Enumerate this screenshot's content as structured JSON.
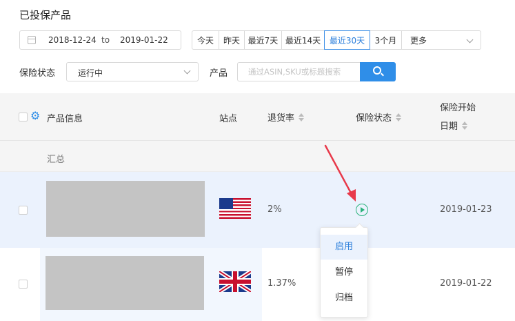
{
  "page": {
    "title": "已投保产品"
  },
  "date_range": {
    "start": "2018-12-24",
    "separator": "to",
    "end": "2019-01-22"
  },
  "range_buttons": [
    {
      "label": "今天",
      "active": false
    },
    {
      "label": "昨天",
      "active": false
    },
    {
      "label": "最近7天",
      "active": false
    },
    {
      "label": "最近14天",
      "active": false
    },
    {
      "label": "最近30天",
      "active": true
    },
    {
      "label": "3个月",
      "active": false
    }
  ],
  "more_select": {
    "label": "更多"
  },
  "filters": {
    "status_label": "保险状态",
    "status_value": "运行中",
    "product_label": "产品",
    "search_placeholder": "通过ASIN,SKU或标题搜索"
  },
  "table": {
    "headers": {
      "product_info": "产品信息",
      "site": "站点",
      "return_rate": "退货率",
      "insurance_status": "保险状态",
      "start_date_line1": "保险开始",
      "start_date_line2": "日期"
    },
    "summary_label": "汇总",
    "rows": [
      {
        "site": "us-flag",
        "return_rate": "2%",
        "status_icon": "play-circle-icon",
        "start_date": "2019-01-23"
      },
      {
        "site": "uk-flag",
        "return_rate": "1.37%",
        "start_date": "2019-01-22"
      }
    ]
  },
  "status_dropdown": {
    "items": [
      "启用",
      "暂停",
      "归档"
    ],
    "active_index": 0
  },
  "colors": {
    "accent": "#2f8ee8",
    "status_green": "#2ab27b",
    "annotation_arrow": "#e8394a",
    "row_highlight": "#ebf2fd"
  }
}
